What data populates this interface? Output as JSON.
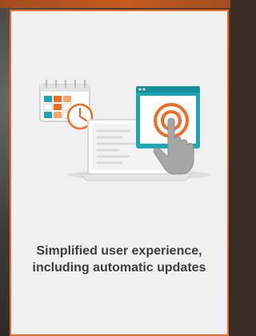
{
  "card": {
    "headline": "Simplified user experience, including automatic updates"
  },
  "illustration": {
    "icons": [
      "calendar-icon",
      "clock-icon",
      "laptop-icon",
      "browser-window-icon",
      "touch-target-icon",
      "hand-pointer-icon"
    ]
  },
  "colors": {
    "accent": "#f36a22",
    "teal": "#1ea6b7",
    "text": "#3d3d3d",
    "card_bg": "#f1f0f0"
  }
}
